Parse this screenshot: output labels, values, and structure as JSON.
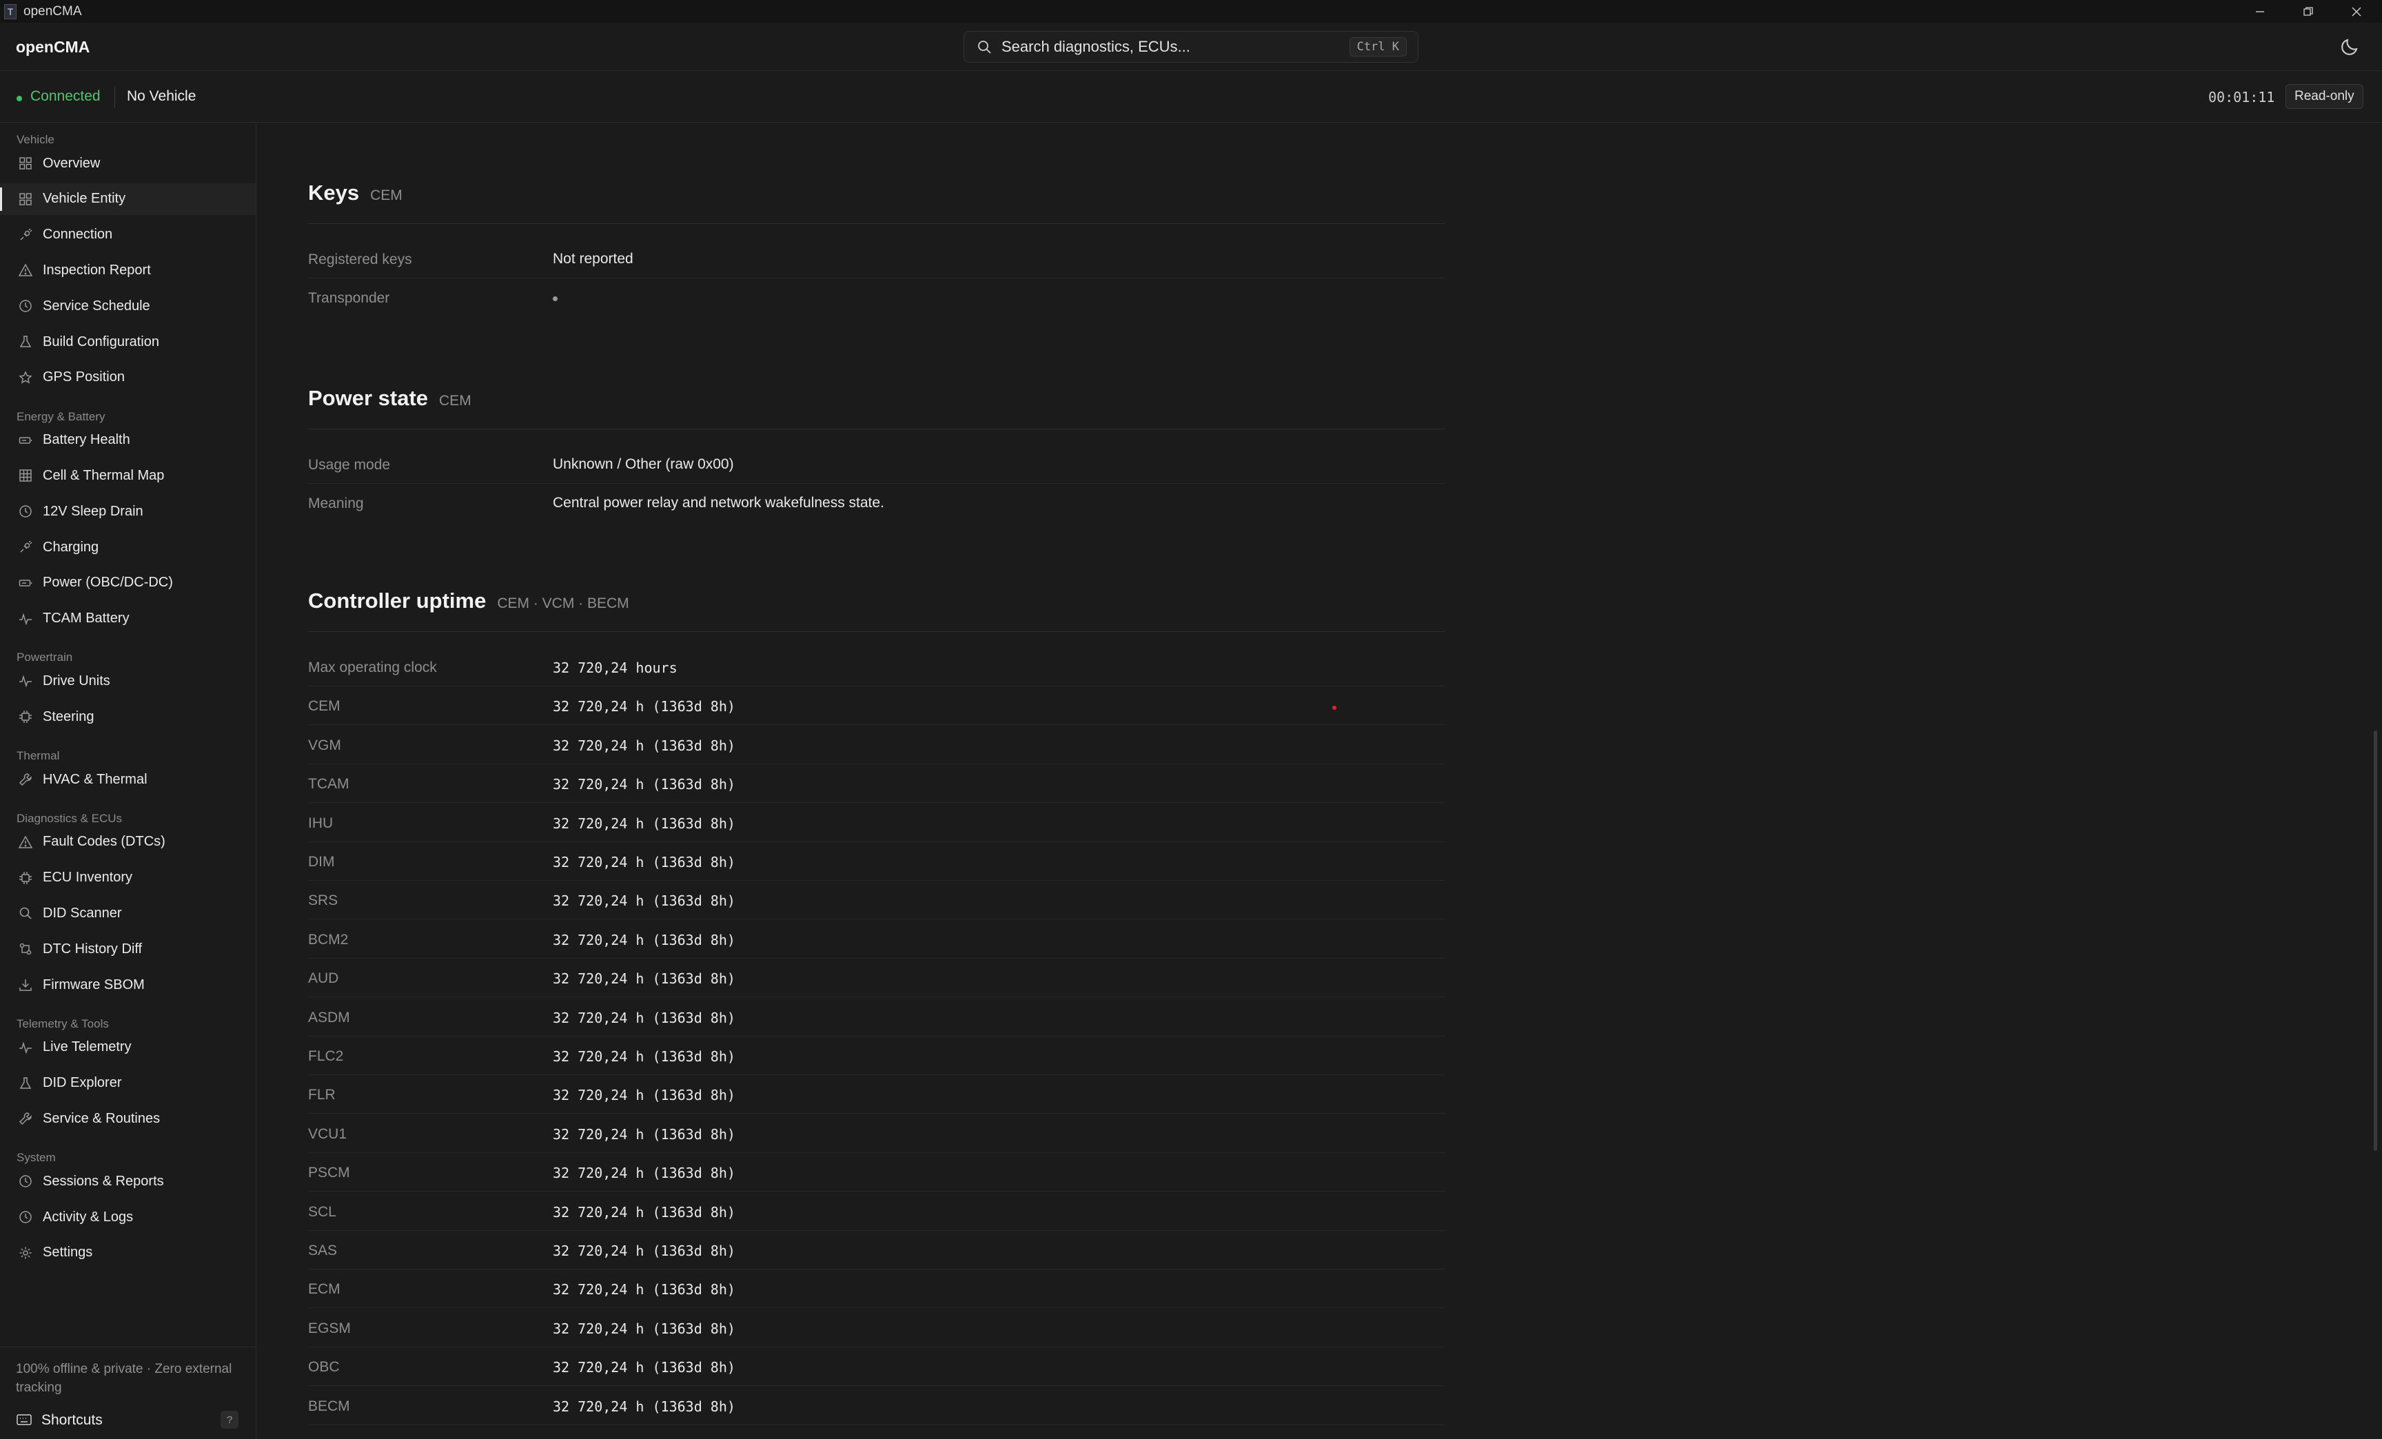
{
  "window": {
    "title": "openCMA",
    "icon_letter": "T"
  },
  "header": {
    "brand": "openCMA",
    "search_placeholder": "Search diagnostics, ECUs...",
    "search_shortcut": "Ctrl K"
  },
  "status": {
    "connection": "Connected",
    "vehicle": "No Vehicle",
    "timer": "00:01:11",
    "mode": "Read-only"
  },
  "sidebar": {
    "sections": [
      {
        "title": "Vehicle",
        "items": [
          {
            "label": "Overview",
            "icon": "grid-icon"
          },
          {
            "label": "Vehicle Entity",
            "icon": "grid-icon",
            "active": true
          },
          {
            "label": "Connection",
            "icon": "plug-icon"
          },
          {
            "label": "Inspection Report",
            "icon": "warning-icon"
          },
          {
            "label": "Service Schedule",
            "icon": "clock-icon"
          },
          {
            "label": "Build Configuration",
            "icon": "flask-icon"
          },
          {
            "label": "GPS Position",
            "icon": "star-icon"
          }
        ]
      },
      {
        "title": "Energy & Battery",
        "items": [
          {
            "label": "Battery Health",
            "icon": "battery-icon"
          },
          {
            "label": "Cell & Thermal Map",
            "icon": "table-icon"
          },
          {
            "label": "12V Sleep Drain",
            "icon": "clock-icon"
          },
          {
            "label": "Charging",
            "icon": "plug-icon"
          },
          {
            "label": "Power (OBC/DC-DC)",
            "icon": "battery-icon"
          },
          {
            "label": "TCAM Battery",
            "icon": "pulse-icon"
          }
        ]
      },
      {
        "title": "Powertrain",
        "items": [
          {
            "label": "Drive Units",
            "icon": "pulse-icon"
          },
          {
            "label": "Steering",
            "icon": "chip-icon"
          }
        ]
      },
      {
        "title": "Thermal",
        "items": [
          {
            "label": "HVAC & Thermal",
            "icon": "wrench-icon"
          }
        ]
      },
      {
        "title": "Diagnostics & ECUs",
        "items": [
          {
            "label": "Fault Codes (DTCs)",
            "icon": "warning-icon"
          },
          {
            "label": "ECU Inventory",
            "icon": "chip-icon"
          },
          {
            "label": "DID Scanner",
            "icon": "search-icon"
          },
          {
            "label": "DTC History Diff",
            "icon": "diff-icon"
          },
          {
            "label": "Firmware SBOM",
            "icon": "download-icon"
          }
        ]
      },
      {
        "title": "Telemetry & Tools",
        "items": [
          {
            "label": "Live Telemetry",
            "icon": "pulse-icon"
          },
          {
            "label": "DID Explorer",
            "icon": "flask-icon"
          },
          {
            "label": "Service & Routines",
            "icon": "wrench-icon"
          }
        ]
      },
      {
        "title": "System",
        "items": [
          {
            "label": "Sessions & Reports",
            "icon": "clock-icon"
          },
          {
            "label": "Activity & Logs",
            "icon": "clock-icon"
          },
          {
            "label": "Settings",
            "icon": "gear-icon"
          }
        ]
      }
    ],
    "footer_note": "100% offline & private · Zero external tracking",
    "shortcuts_label": "Shortcuts",
    "shortcuts_key": "?"
  },
  "main": {
    "keys": {
      "title": "Keys",
      "tag": "CEM",
      "rows": [
        {
          "k": "Registered keys",
          "v": "Not reported"
        },
        {
          "k": "Transponder",
          "v": ""
        }
      ]
    },
    "power": {
      "title": "Power state",
      "tag": "CEM",
      "rows": [
        {
          "k": "Usage mode",
          "v": "Unknown / Other (raw 0x00)"
        },
        {
          "k": "Meaning",
          "v": "Central power relay and network wakefulness state."
        }
      ]
    },
    "uptime": {
      "title": "Controller uptime",
      "tag": "CEM · VCM · BECM",
      "rows": [
        {
          "k": "Max operating clock",
          "v": "32 720,24 hours"
        },
        {
          "k": "CEM",
          "v": "32 720,24 h (1363d 8h)"
        },
        {
          "k": "VGM",
          "v": "32 720,24 h (1363d 8h)"
        },
        {
          "k": "TCAM",
          "v": "32 720,24 h (1363d 8h)"
        },
        {
          "k": "IHU",
          "v": "32 720,24 h (1363d 8h)"
        },
        {
          "k": "DIM",
          "v": "32 720,24 h (1363d 8h)"
        },
        {
          "k": "SRS",
          "v": "32 720,24 h (1363d 8h)"
        },
        {
          "k": "BCM2",
          "v": "32 720,24 h (1363d 8h)"
        },
        {
          "k": "AUD",
          "v": "32 720,24 h (1363d 8h)"
        },
        {
          "k": "ASDM",
          "v": "32 720,24 h (1363d 8h)"
        },
        {
          "k": "FLC2",
          "v": "32 720,24 h (1363d 8h)"
        },
        {
          "k": "FLR",
          "v": "32 720,24 h (1363d 8h)"
        },
        {
          "k": "VCU1",
          "v": "32 720,24 h (1363d 8h)"
        },
        {
          "k": "PSCM",
          "v": "32 720,24 h (1363d 8h)"
        },
        {
          "k": "SCL",
          "v": "32 720,24 h (1363d 8h)"
        },
        {
          "k": "SAS",
          "v": "32 720,24 h (1363d 8h)"
        },
        {
          "k": "ECM",
          "v": "32 720,24 h (1363d 8h)"
        },
        {
          "k": "EGSM",
          "v": "32 720,24 h (1363d 8h)"
        },
        {
          "k": "OBC",
          "v": "32 720,24 h (1363d 8h)"
        },
        {
          "k": "BECM",
          "v": "32 720,24 h (1363d 8h)"
        }
      ]
    }
  }
}
